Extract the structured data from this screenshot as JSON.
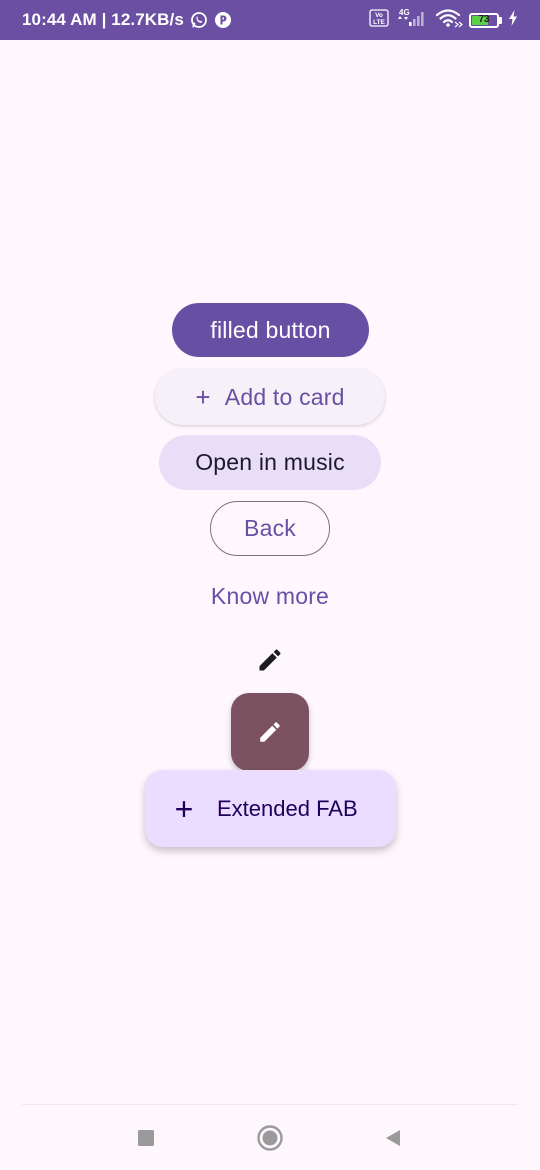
{
  "status_bar": {
    "time_speed": "10:44 AM | 12.7KB/s",
    "network_badge_top": "Vo",
    "network_badge_bottom": "LTE",
    "network_type": "4G",
    "battery": "73",
    "battery_level_percent": 73,
    "icons": [
      "whatsapp-icon",
      "app-notification-icon",
      "volte-icon",
      "signal-icon",
      "wifi-icon",
      "battery-icon",
      "charging-icon"
    ]
  },
  "buttons": {
    "filled": "filled button",
    "elevated_icon": "+",
    "elevated": "Add to card",
    "tonal": "Open in music",
    "outlined": "Back",
    "text": "Know more"
  },
  "icon_button": {
    "icon": "edit-icon"
  },
  "fab": {
    "icon": "edit-icon"
  },
  "extended_fab": {
    "icon": "+",
    "label": "Extended FAB"
  },
  "nav_bar": {
    "icons": [
      "recents-square-icon",
      "home-circle-icon",
      "back-triangle-icon"
    ]
  },
  "colors": {
    "status_bar": "#6A4FA3",
    "background": "#FEF7FD",
    "primary": "#6750A4",
    "tonal_container": "#E8DEF8",
    "fab_container": "#7D5260",
    "extended_fab_container": "#EADDFF",
    "battery_fill": "#5BD14A"
  }
}
